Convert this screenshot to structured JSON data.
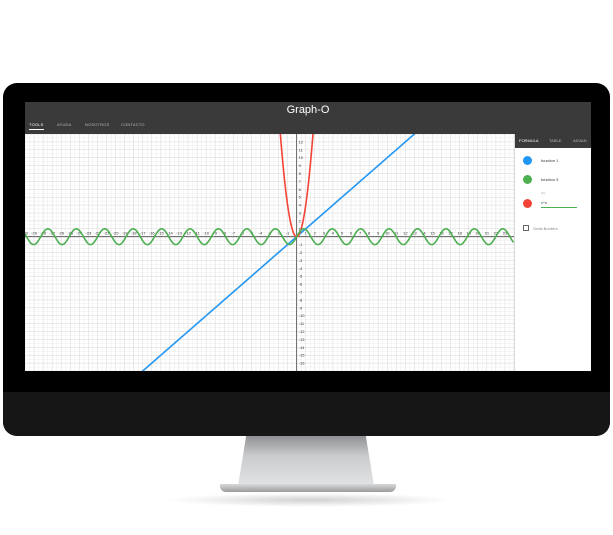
{
  "window": {
    "title": "Graph-O"
  },
  "tabs": [
    {
      "label": "TOOLS",
      "active": true
    },
    {
      "label": "AYUDA",
      "active": false
    },
    {
      "label": "NOSOTROS",
      "active": false
    },
    {
      "label": "CONTACTO",
      "active": false
    }
  ],
  "side_panel": {
    "tabs": [
      {
        "label": "FORMULA",
        "active": true
      },
      {
        "label": "TABLE",
        "active": false
      },
      {
        "label": "ADVAN",
        "active": false
      }
    ],
    "functions": [
      {
        "label": "function 1",
        "color": "#2196f3"
      },
      {
        "label": "function 3",
        "color": "#4caf50"
      },
      {
        "label": "x^x",
        "caption": "f(x)",
        "color": "#f44336"
      }
    ],
    "checkbox_label": "Grids Borders"
  },
  "chart_data": {
    "type": "line",
    "x_ticks": [
      "-30",
      "-29",
      "-28",
      "-27",
      "-26",
      "-25",
      "-24",
      "-23",
      "-22",
      "-21",
      "-20",
      "-19",
      "-18",
      "-17",
      "-16",
      "-15",
      "-14",
      "-13",
      "-12",
      "-11",
      "-10",
      "-9",
      "-8",
      "-7",
      "-6",
      "-5",
      "-4",
      "-3",
      "-2",
      "-1",
      "1",
      "2",
      "3",
      "4",
      "5",
      "6",
      "7",
      "8",
      "9",
      "10",
      "11",
      "12",
      "13",
      "14",
      "15",
      "16",
      "17",
      "18",
      "19",
      "20",
      "21",
      "22",
      "23"
    ],
    "y_ticks": [
      "12",
      "11",
      "10",
      "9",
      "8",
      "7",
      "6",
      "5",
      "4",
      "3",
      "2",
      "1",
      "-1",
      "-2",
      "-3",
      "-4",
      "-5",
      "-6",
      "-7",
      "-8",
      "-9",
      "-10",
      "-11",
      "-12",
      "-13",
      "-14",
      "-15",
      "-16"
    ],
    "xlim": [
      -30,
      24
    ],
    "ylim": [
      -17,
      13
    ],
    "grid": true,
    "series": [
      {
        "fn": "linear",
        "color": "#2196f3",
        "slope": 1,
        "intercept": 0
      },
      {
        "fn": "parabola",
        "color": "#f44336",
        "coef": 4,
        "domain": [
          -1.9,
          1.9
        ]
      },
      {
        "fn": "sine",
        "color": "#4caf50",
        "amplitude": 1,
        "period": 3.14
      }
    ]
  }
}
